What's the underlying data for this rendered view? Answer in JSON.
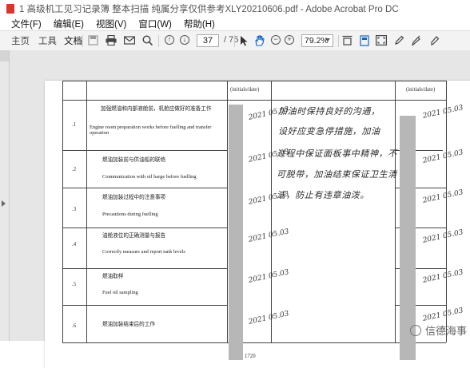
{
  "window": {
    "title": "1 高级机工见习记录簿  整本扫描  纯属分享仅供参考XLY20210606.pdf - Adobe Acrobat Pro DC"
  },
  "menu": [
    "文件(F)",
    "编辑(E)",
    "视图(V)",
    "窗口(W)",
    "帮助(H)"
  ],
  "toolbar": {
    "tabs": [
      "主页",
      "工具",
      "文档"
    ],
    "page_current": "37",
    "page_total": "/ 75",
    "zoom": "79.2%"
  },
  "table": {
    "col_headers": [
      "(initials/date)",
      "(initials/date)"
    ],
    "rows": [
      {
        "num": ".1",
        "zh": "加强燃油和内部液舱前，机舱应做好的准备工作",
        "en": "Engine room preparation works before fuelling and transfer operation"
      },
      {
        "num": ".2",
        "zh": "燃油加装前与供油船的联络",
        "en": "Communication with oil barge before fuelling"
      },
      {
        "num": ".3",
        "zh": "燃油加装过程中的注意事项",
        "en": "Precautions during fuelling"
      },
      {
        "num": ".4",
        "zh": "油舱液位的正确测量与报告",
        "en": "Correctly measure and report tank levels"
      },
      {
        "num": ".5",
        "zh": "燃油取样",
        "en": "Fuel oil sampling"
      },
      {
        "num": ".6",
        "zh": "燃油加装结束后的工作",
        "en": ""
      }
    ],
    "signature_date": "2021 05.03",
    "handwritten_note": [
      "加油时保持良好的沟通，",
      "设好应变急停措施，加油",
      "过程中保证面板事中精神，不",
      "可脱带，加油结束保证卫生清",
      "洁，防止有违章油泼。"
    ],
    "page_number": "1720"
  },
  "watermark": "信德海事"
}
